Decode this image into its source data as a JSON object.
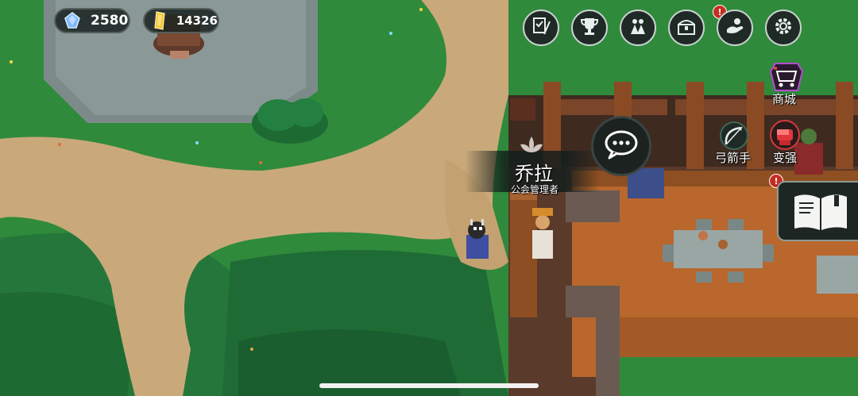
{
  "currencies": {
    "crystals": {
      "value": "2580",
      "icon": "blue-crystal-icon"
    },
    "gold": {
      "value": "14326",
      "icon": "gold-bar-icon"
    }
  },
  "top_menu": [
    {
      "icon": "quest-scroll-icon"
    },
    {
      "icon": "trophy-icon"
    },
    {
      "icon": "heroes-icon"
    },
    {
      "icon": "treasure-chest-icon",
      "alert": "!"
    },
    {
      "icon": "hand-offer-icon"
    },
    {
      "icon": "settings-gear-icon"
    }
  ],
  "shop": {
    "label": "商城",
    "icon": "shop-cart-icon"
  },
  "archer": {
    "label": "弓箭手",
    "icon": "bow-arrow-icon"
  },
  "strengthen": {
    "label": "变强",
    "icon": "fist-icon",
    "alert": "!"
  },
  "journal": {
    "icon": "open-book-icon"
  },
  "npc": {
    "name": "乔拉",
    "title": "公会管理者",
    "talk_icon": "speech-bubble-icon",
    "emblem_icon": "guild-emblem-icon"
  },
  "colors": {
    "grass": "#2f8a3b",
    "path": "#c9a97a",
    "floor": "#b9672c",
    "hud_bg": "#1f2a27"
  }
}
